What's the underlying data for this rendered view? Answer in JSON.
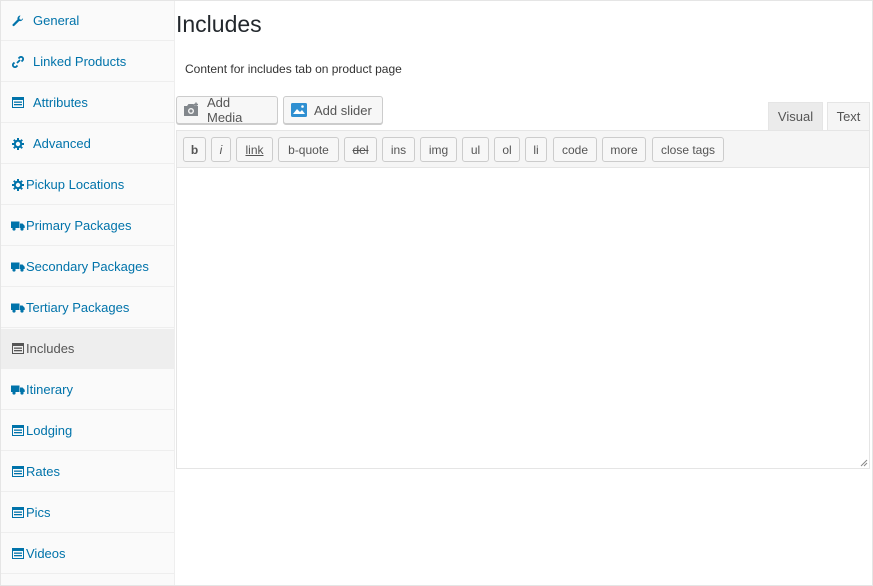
{
  "sidebar": {
    "items": [
      {
        "label": "General",
        "icon": "wrench-icon",
        "active": false
      },
      {
        "label": "Linked Products",
        "icon": "link-icon",
        "active": false
      },
      {
        "label": "Attributes",
        "icon": "list-icon",
        "active": false
      },
      {
        "label": "Advanced",
        "icon": "gear-icon",
        "active": false
      },
      {
        "label": "Pickup Locations",
        "icon": "gear-icon",
        "active": false
      },
      {
        "label": "Primary Packages",
        "icon": "truck-icon",
        "active": false
      },
      {
        "label": "Secondary Packages",
        "icon": "truck-icon",
        "active": false
      },
      {
        "label": "Tertiary Packages",
        "icon": "truck-icon",
        "active": false
      },
      {
        "label": "Includes",
        "icon": "list-icon",
        "active": true
      },
      {
        "label": "Itinerary",
        "icon": "truck-icon",
        "active": false
      },
      {
        "label": "Lodging",
        "icon": "list-icon",
        "active": false
      },
      {
        "label": "Rates",
        "icon": "list-icon",
        "active": false
      },
      {
        "label": "Pics",
        "icon": "list-icon",
        "active": false
      },
      {
        "label": "Videos",
        "icon": "list-icon",
        "active": false
      }
    ]
  },
  "main": {
    "title": "Includes",
    "description": "Content for includes tab on product page",
    "add_media_label": "Add Media",
    "add_slider_label": "Add slider",
    "tabs": {
      "visual": "Visual",
      "text": "Text"
    },
    "quicktags": [
      "b",
      "i",
      "link",
      "b-quote",
      "del",
      "ins",
      "img",
      "ul",
      "ol",
      "li",
      "code",
      "more",
      "close tags"
    ],
    "editor_value": ""
  },
  "colors": {
    "link": "#0073aa",
    "active_bg": "#eeeeee",
    "sidebar_bg": "#fafafa"
  }
}
